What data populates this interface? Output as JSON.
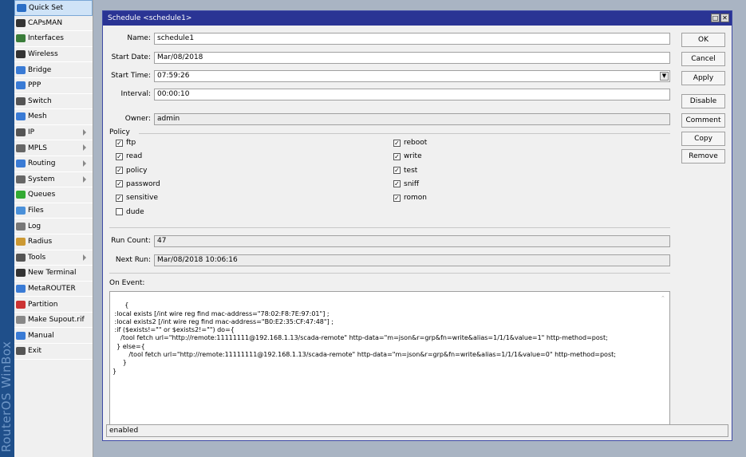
{
  "brand": "RouterOS WinBox",
  "sidebar": {
    "items": [
      {
        "label": "Quick Set",
        "icon": "quick-set-icon",
        "arrow": false
      },
      {
        "label": "CAPsMAN",
        "icon": "antenna-icon",
        "arrow": false
      },
      {
        "label": "Interfaces",
        "icon": "interfaces-icon",
        "arrow": false
      },
      {
        "label": "Wireless",
        "icon": "antenna-icon",
        "arrow": false
      },
      {
        "label": "Bridge",
        "icon": "bridge-icon",
        "arrow": false
      },
      {
        "label": "PPP",
        "icon": "ppp-icon",
        "arrow": false
      },
      {
        "label": "Switch",
        "icon": "switch-icon",
        "arrow": false
      },
      {
        "label": "Mesh",
        "icon": "mesh-icon",
        "arrow": false
      },
      {
        "label": "IP",
        "icon": "ip-icon",
        "arrow": true
      },
      {
        "label": "MPLS",
        "icon": "mpls-icon",
        "arrow": true
      },
      {
        "label": "Routing",
        "icon": "routing-icon",
        "arrow": true
      },
      {
        "label": "System",
        "icon": "gear-icon",
        "arrow": true
      },
      {
        "label": "Queues",
        "icon": "queues-icon",
        "arrow": false
      },
      {
        "label": "Files",
        "icon": "folder-icon",
        "arrow": false
      },
      {
        "label": "Log",
        "icon": "log-icon",
        "arrow": false
      },
      {
        "label": "Radius",
        "icon": "users-icon",
        "arrow": false
      },
      {
        "label": "Tools",
        "icon": "tools-icon",
        "arrow": true
      },
      {
        "label": "New Terminal",
        "icon": "terminal-icon",
        "arrow": false
      },
      {
        "label": "MetaROUTER",
        "icon": "metarouter-icon",
        "arrow": false
      },
      {
        "label": "Partition",
        "icon": "pie-icon",
        "arrow": false
      },
      {
        "label": "Make Supout.rif",
        "icon": "document-icon",
        "arrow": false
      },
      {
        "label": "Manual",
        "icon": "help-icon",
        "arrow": false
      },
      {
        "label": "Exit",
        "icon": "exit-icon",
        "arrow": false
      }
    ]
  },
  "window": {
    "title": "Schedule <schedule1>",
    "min_btn": "□",
    "close_btn": "✕"
  },
  "form": {
    "name_label": "Name:",
    "name_value": "schedule1",
    "start_date_label": "Start Date:",
    "start_date_value": "Mar/08/2018",
    "start_time_label": "Start Time:",
    "start_time_value": "07:59:26",
    "interval_label": "Interval:",
    "interval_value": "00:00:10",
    "owner_label": "Owner:",
    "owner_value": "admin",
    "policy_label": "Policy",
    "run_count_label": "Run Count:",
    "run_count_value": "47",
    "next_run_label": "Next Run:",
    "next_run_value": "Mar/08/2018 10:06:16",
    "on_event_label": "On Event:",
    "on_event_value": "{\n :local exists [/int wire reg find mac-address=\"78:02:F8:7E:97:01\"] ;\n :local exists2 [/int wire reg find mac-address=\"B0:E2:35:CF:47:48\"] ;\n :if ($exists!=\"\" or $exists2!=\"\") do={\n    /tool fetch url=\"http://remote:11111111@192.168.1.13/scada-remote\" http-data=\"m=json&r=grp&fn=write&alias=1/1/1&value=1\" http-method=post;\n  } else={\n        /tool fetch url=\"http://remote:11111111@192.168.1.13/scada-remote\" http-data=\"m=json&r=grp&fn=write&alias=1/1/1&value=0\" http-method=post;\n     }\n}"
  },
  "policy": {
    "left": [
      {
        "label": "ftp",
        "checked": true
      },
      {
        "label": "read",
        "checked": true
      },
      {
        "label": "policy",
        "checked": true
      },
      {
        "label": "password",
        "checked": true
      },
      {
        "label": "sensitive",
        "checked": true
      },
      {
        "label": "dude",
        "checked": false
      }
    ],
    "right": [
      {
        "label": "reboot",
        "checked": true
      },
      {
        "label": "write",
        "checked": true
      },
      {
        "label": "test",
        "checked": true
      },
      {
        "label": "sniff",
        "checked": true
      },
      {
        "label": "romon",
        "checked": true
      }
    ]
  },
  "buttons": {
    "ok": "OK",
    "cancel": "Cancel",
    "apply": "Apply",
    "disable": "Disable",
    "comment": "Comment",
    "copy": "Copy",
    "remove": "Remove"
  },
  "status": "enabled",
  "colors": {
    "titlebar": "#2a3494",
    "brand_strip": "#1f4f8a",
    "desktop": "#a9b4c3"
  }
}
